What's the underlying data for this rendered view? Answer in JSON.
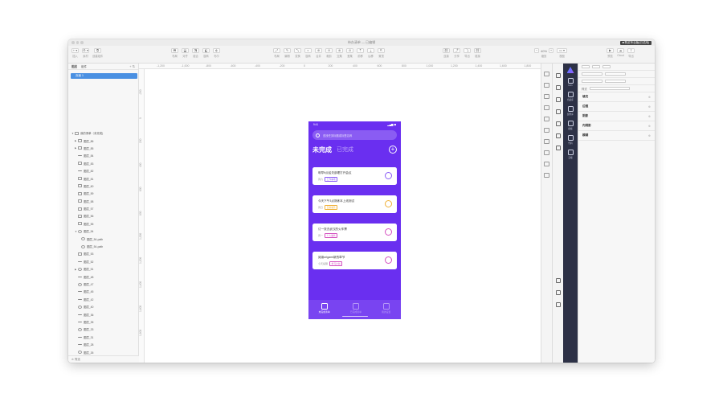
{
  "window": {
    "title": "待办清单 — 已编辑",
    "upgrade_label": "■ 购买专业版(已试用)"
  },
  "toolbar": {
    "left_items": [
      {
        "btn": "+ ▾",
        "label": "插入"
      },
      {
        "btn": "⚙ ▾",
        "label": "素材"
      },
      {
        "btn": "⧉",
        "label": "创建组件"
      }
    ],
    "mid_items": [
      {
        "btn": "⬒",
        "label": "布局"
      },
      {
        "btn": "⬓",
        "label": "对齐"
      },
      {
        "btn": "⬔",
        "label": "组合"
      },
      {
        "btn": "⬕",
        "label": "旋转"
      },
      {
        "btn": "⬖",
        "label": "布尔"
      }
    ],
    "right_items": [
      {
        "btn": "⤢",
        "label": "布局"
      },
      {
        "btn": "✎",
        "label": "编辑"
      },
      {
        "btn": "⤡",
        "label": "变换"
      },
      {
        "btn": "◐",
        "label": "旋转"
      },
      {
        "btn": "⊕",
        "label": "合并"
      },
      {
        "btn": "⊖",
        "label": "裁剪"
      },
      {
        "btn": "⊗",
        "label": "交集"
      },
      {
        "btn": "⊘",
        "label": "差集"
      },
      {
        "btn": "⤒",
        "label": "前移"
      },
      {
        "btn": "⤓",
        "label": "后移"
      },
      {
        "btn": "⇱",
        "label": "置顶"
      }
    ],
    "link_items": [
      {
        "btn": "⛓",
        "label": "连接"
      },
      {
        "btn": "⤴",
        "label": "分享"
      },
      {
        "btn": "⤵",
        "label": "导出"
      },
      {
        "btn": "⛓",
        "label": "链接"
      }
    ],
    "zoom": {
      "minus": "−",
      "value": "40%",
      "plus": "+",
      "label": "缩放"
    },
    "view": {
      "btn": "▭ ▾",
      "label": "视图"
    },
    "far_right": [
      {
        "btn": "▶",
        "label": "预览"
      },
      {
        "btn": "☁",
        "label": "Cloud"
      },
      {
        "btn": "⇪",
        "label": "导出"
      }
    ]
  },
  "left_panel": {
    "tabs": [
      "图层",
      "组件"
    ],
    "tools": "+ ⇅",
    "page_name": "页面 1",
    "layers": [
      {
        "name": "我的清单（未完成)",
        "arrow": "▼",
        "icon": "box",
        "indent": 0
      },
      {
        "name": "图层_86",
        "arrow": "▶",
        "icon": "box",
        "indent": 1
      },
      {
        "name": "图层_85",
        "arrow": "▶",
        "icon": "box",
        "indent": 1
      },
      {
        "name": "图层_84",
        "arrow": "",
        "icon": "line",
        "indent": 1
      },
      {
        "name": "图层_83",
        "arrow": "",
        "icon": "box",
        "indent": 1
      },
      {
        "name": "图层_82",
        "arrow": "",
        "icon": "line",
        "indent": 1
      },
      {
        "name": "图层_81",
        "arrow": "",
        "icon": "box",
        "indent": 1
      },
      {
        "name": "图层_60",
        "arrow": "",
        "icon": "box",
        "indent": 1
      },
      {
        "name": "图层_59",
        "arrow": "",
        "icon": "box",
        "indent": 1
      },
      {
        "name": "图层_58",
        "arrow": "",
        "icon": "box",
        "indent": 1
      },
      {
        "name": "图层_57",
        "arrow": "",
        "icon": "box",
        "indent": 1
      },
      {
        "name": "图层_56",
        "arrow": "",
        "icon": "box",
        "indent": 1
      },
      {
        "name": "图层_55",
        "arrow": "",
        "icon": "box",
        "indent": 1
      },
      {
        "name": "图层_54",
        "arrow": "▼",
        "icon": "circ",
        "indent": 1
      },
      {
        "name": "图层_54-path",
        "arrow": "",
        "icon": "circ",
        "indent": 2
      },
      {
        "name": "图层_54-path",
        "arrow": "",
        "icon": "circ",
        "indent": 2
      },
      {
        "name": "图层_53",
        "arrow": "",
        "icon": "box",
        "indent": 1
      },
      {
        "name": "图层_52",
        "arrow": "",
        "icon": "line",
        "indent": 1
      },
      {
        "name": "图层_51",
        "arrow": "▶",
        "icon": "circ",
        "indent": 1
      },
      {
        "name": "图层_48",
        "arrow": "",
        "icon": "line",
        "indent": 1
      },
      {
        "name": "图层_47",
        "arrow": "",
        "icon": "circ",
        "indent": 1
      },
      {
        "name": "图层_45",
        "arrow": "",
        "icon": "line",
        "indent": 1
      },
      {
        "name": "图层_42",
        "arrow": "",
        "icon": "line",
        "indent": 1
      },
      {
        "name": "图层_40",
        "arrow": "",
        "icon": "circ",
        "indent": 1
      },
      {
        "name": "图层_36",
        "arrow": "",
        "icon": "line",
        "indent": 1
      },
      {
        "name": "图层_35",
        "arrow": "",
        "icon": "line",
        "indent": 1
      },
      {
        "name": "图层_33",
        "arrow": "",
        "icon": "circ",
        "indent": 1
      },
      {
        "name": "图层_31",
        "arrow": "",
        "icon": "line",
        "indent": 1
      },
      {
        "name": "图层_28",
        "arrow": "",
        "icon": "line",
        "indent": 1
      },
      {
        "name": "图层_26",
        "arrow": "",
        "icon": "circ",
        "indent": 1
      },
      {
        "name": "图层_24",
        "arrow": "",
        "icon": "line",
        "indent": 1
      },
      {
        "name": "图层_22",
        "arrow": "",
        "icon": "line",
        "indent": 1
      }
    ],
    "bottom_label": "⊘ 筛选"
  },
  "rulers": {
    "h_ticks": [
      "-1,200",
      "-1,000",
      "-800",
      "-600",
      "-400",
      "-200",
      "0",
      "200",
      "400",
      "600",
      "800",
      "1,000",
      "1,200",
      "1,400",
      "1,600",
      "1,800"
    ],
    "v_ticks": [
      "-200",
      "0",
      "200",
      "400",
      "600",
      "800",
      "1,000",
      "1,200",
      "1,400",
      "1,600",
      "1,800"
    ]
  },
  "phone": {
    "bg_color": "#6a2ff0",
    "time": "9:41",
    "signal": "▂▄▆ ◼",
    "search_placeholder": "查找任务标题或标签名称",
    "tab_active": "未完成",
    "tab_inactive": "已完成",
    "add_icon": "+",
    "tasks": [
      {
        "title": "明早9点给关部理打开会议",
        "meta": "周六",
        "tag": "工作事项",
        "color": "#8a5cf6"
      },
      {
        "title": "今天下午3点熟练本上线测试",
        "meta": "周日",
        "tag": "日常事务",
        "color": "#f0b13a"
      },
      {
        "title": "订一张去武汉的火车票",
        "meta": "周一",
        "tag": "个人事务",
        "color": "#d44fc0"
      },
      {
        "title": "阅读origami新的章节",
        "meta": "今天提醒",
        "tag": "学习计划",
        "color": "#d44fc0"
      }
    ],
    "tabbar": [
      {
        "label": "未完成清单",
        "on": true
      },
      {
        "label": "已完成清单",
        "on": false
      },
      {
        "label": "我的设置",
        "on": false
      }
    ]
  },
  "plugin_bar": {
    "items": [
      "Icon",
      "色彩库",
      "组件库",
      "模板",
      "代码",
      "云端"
    ]
  },
  "inspector": {
    "row1": "样式",
    "sections": [
      "填充",
      "边框",
      "阴影",
      "内阴影",
      "模糊"
    ]
  }
}
